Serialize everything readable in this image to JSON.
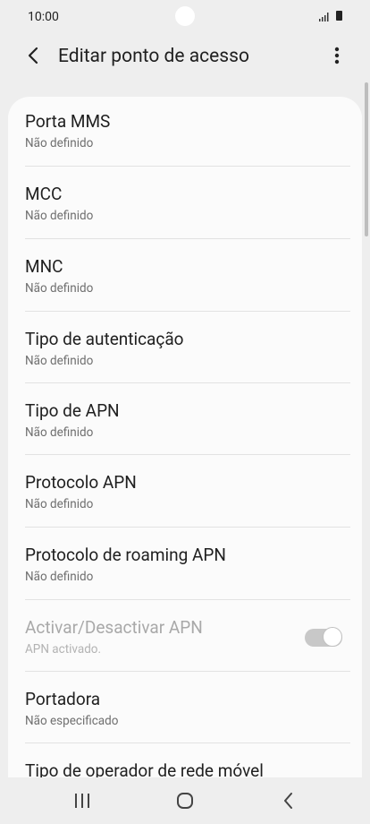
{
  "status": {
    "time": "10:00"
  },
  "appbar": {
    "title": "Editar ponto de acesso"
  },
  "items": [
    {
      "title": "Porta MMS",
      "subtitle": "Não definido"
    },
    {
      "title": "MCC",
      "subtitle": "Não definido"
    },
    {
      "title": "MNC",
      "subtitle": "Não definido"
    },
    {
      "title": "Tipo de autenticação",
      "subtitle": "Não definido"
    },
    {
      "title": "Tipo de APN",
      "subtitle": "Não definido"
    },
    {
      "title": "Protocolo APN",
      "subtitle": "Não definido"
    },
    {
      "title": "Protocolo de roaming APN",
      "subtitle": "Não definido"
    },
    {
      "title": "Activar/Desactivar APN",
      "subtitle": "APN activado."
    },
    {
      "title": "Portadora",
      "subtitle": "Não especificado"
    },
    {
      "title": "Tipo de operador de rede móvel",
      "subtitle": ""
    }
  ],
  "apn_toggle": {
    "state": "on",
    "enabled": false
  }
}
